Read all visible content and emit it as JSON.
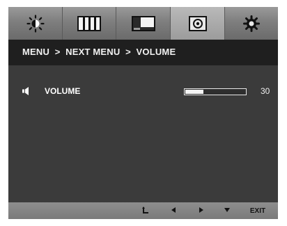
{
  "tabs": [
    {
      "name": "brightness-icon",
      "active": false
    },
    {
      "name": "color-bars-icon",
      "active": false
    },
    {
      "name": "picture-window-icon",
      "active": false
    },
    {
      "name": "audio-speaker-icon",
      "active": true
    },
    {
      "name": "setup-gear-icon",
      "active": false
    }
  ],
  "breadcrumb": "MENU  >  NEXT MENU  >  VOLUME",
  "volume": {
    "label": "VOLUME",
    "value": "30",
    "level": 0.3
  },
  "bottom": {
    "exit_label": "EXIT",
    "buttons": [
      "return-icon",
      "left-arrow-icon",
      "right-arrow-icon",
      "down-arrow-icon"
    ]
  },
  "colors": {
    "panel": "#3a3a3a",
    "header": "#1f1f1f",
    "bar": "#808080"
  }
}
